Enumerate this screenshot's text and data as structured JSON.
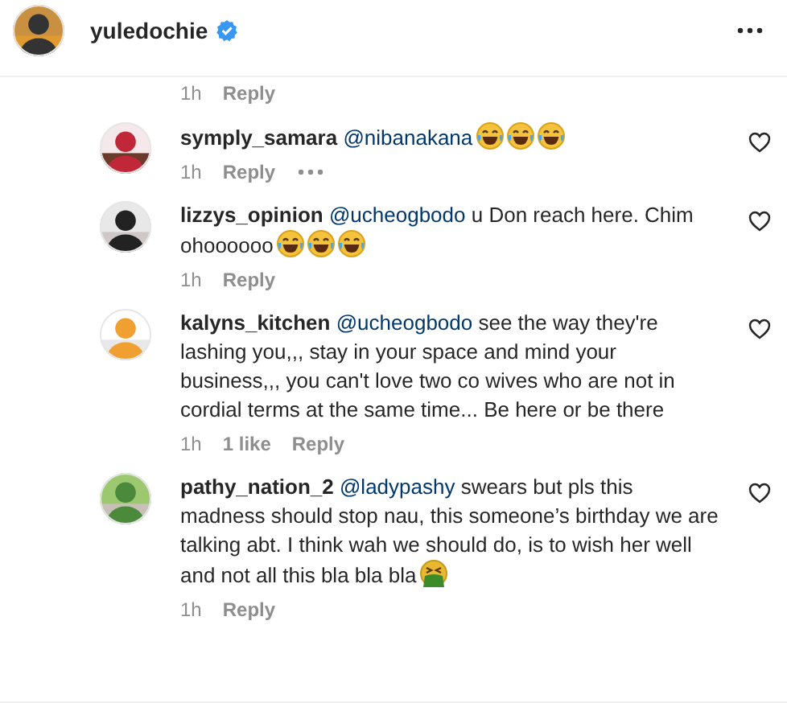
{
  "post_header": {
    "username": "yuledochie",
    "verified": true
  },
  "previous_meta": {
    "time": "1h",
    "reply": "Reply"
  },
  "comments": [
    {
      "username": "symply_samara",
      "mention": "@nibanakana",
      "emojis": [
        {
          "kind": "laughing"
        },
        {
          "kind": "laughing"
        },
        {
          "kind": "laughing"
        }
      ],
      "time": "1h",
      "reply": "Reply",
      "more_options": true
    },
    {
      "username": "lizzys_opinion",
      "mention": "@ucheogbodo",
      "text": "u Don reach here. Chim ohoooooo",
      "emojis": [
        {
          "kind": "laughing"
        },
        {
          "kind": "laughing"
        },
        {
          "kind": "laughing"
        }
      ],
      "time": "1h",
      "reply": "Reply",
      "more_options": false
    },
    {
      "username": "kalyns_kitchen",
      "mention": "@ucheogbodo",
      "text": "see the way they're lashing you,,, stay in your space and mind your business,,, you can't love two co wives who are not in cordial terms at the same time... Be here or be there",
      "time": "1h",
      "likes": "1 like",
      "reply": "Reply",
      "more_options": false
    },
    {
      "username": "pathy_nation_2",
      "mention": "@ladypashy",
      "text": "swears but pls this madness should stop nau, this someone’s birthday we are talking abt. I think wah we should do, is to wish her well and not all this bla bla bla",
      "emojis": [
        {
          "kind": "vomiting"
        }
      ],
      "time": "1h",
      "reply": "Reply",
      "more_options": false
    }
  ]
}
